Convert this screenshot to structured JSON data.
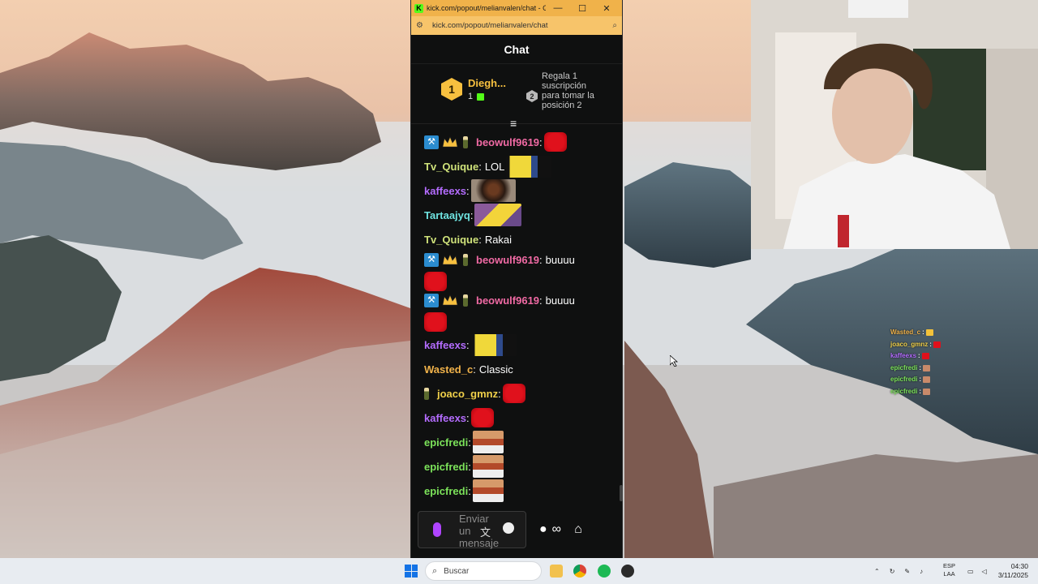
{
  "browser": {
    "window_title": "kick.com/popout/melianvalen/chat - Goo...",
    "url": "kick.com/popout/melianvalen/chat",
    "favicon_letter": "K",
    "window_buttons": {
      "minimize": "—",
      "maximize": "☐",
      "close": "✕"
    }
  },
  "chat": {
    "header": "Chat",
    "leaderboard": {
      "rank1_number": "1",
      "rank1_name": "Diegh...",
      "rank1_count": "1",
      "rank2_number": "2",
      "cta": "Regala 1 suscripción para tomar la posición 2"
    },
    "messages": [
      {
        "user": "beowulf9619",
        "color": "#f06aa4",
        "badges": [
          "mod",
          "vip",
          "bottle"
        ],
        "text": "",
        "emote": "red"
      },
      {
        "user": "Tv_Quique",
        "color": "#cfe27a",
        "badges": [],
        "text": "LOL",
        "emote": "minion"
      },
      {
        "user": "kaffeexs",
        "color": "#b46cff",
        "badges": [],
        "text": "",
        "emote": "dark"
      },
      {
        "user": "Tartaajyq",
        "color": "#6fe3e0",
        "badges": [],
        "text": "",
        "emote": "simpson"
      },
      {
        "user": "Tv_Quique",
        "color": "#cfe27a",
        "badges": [],
        "text": "Rakai",
        "emote": ""
      },
      {
        "user": "beowulf9619",
        "color": "#f06aa4",
        "badges": [
          "mod",
          "vip",
          "bottle"
        ],
        "text": "buuuu",
        "emote": "red-below"
      },
      {
        "user": "beowulf9619",
        "color": "#f06aa4",
        "badges": [
          "mod",
          "vip",
          "bottle"
        ],
        "text": "buuuu",
        "emote": "red-below"
      },
      {
        "user": "kaffeexs",
        "color": "#b46cff",
        "badges": [],
        "text": "",
        "emote": "minion"
      },
      {
        "user": "Wasted_c",
        "color": "#f0b24a",
        "badges": [],
        "text": "Classic",
        "emote": ""
      },
      {
        "user": "joaco_gmnz",
        "color": "#f0d04a",
        "badges": [
          "bottle"
        ],
        "text": "",
        "emote": "red"
      },
      {
        "user": "kaffeexs",
        "color": "#b46cff",
        "badges": [],
        "text": "",
        "emote": "red"
      },
      {
        "user": "epicfredi",
        "color": "#7ce35a",
        "badges": [],
        "text": "",
        "emote": "pic"
      },
      {
        "user": "epicfredi",
        "color": "#7ce35a",
        "badges": [],
        "text": "",
        "emote": "pic"
      },
      {
        "user": "epicfredi",
        "color": "#7ce35a",
        "badges": [],
        "text": "",
        "emote": "pic"
      }
    ],
    "input_placeholder": "Enviar un mensaje",
    "icons": [
      "mic-icon",
      "translate-icon",
      "emoji-icon",
      "points-icon",
      "infinity-icon",
      "store-icon"
    ]
  },
  "overlay_chat": [
    {
      "user": "Wasted_c",
      "color": "#f0b24a",
      "emote_color": "#f3c23a"
    },
    {
      "user": "joaco_gmnz",
      "color": "#f0d04a",
      "emote_color": "#e0111c"
    },
    {
      "user": "kaffeexs",
      "color": "#b46cff",
      "emote_color": "#e0111c"
    },
    {
      "user": "epicfredi",
      "color": "#7ce35a",
      "emote_color": "#c98a6a"
    },
    {
      "user": "epicfredi",
      "color": "#7ce35a",
      "emote_color": "#c98a6a"
    },
    {
      "user": "epicfredi",
      "color": "#7ce35a",
      "emote_color": "#c98a6a"
    }
  ],
  "taskbar": {
    "search_placeholder": "Buscar",
    "lang_line1": "ESP",
    "lang_line2": "LAA",
    "time": "04:30",
    "date": "3/11/2025"
  }
}
